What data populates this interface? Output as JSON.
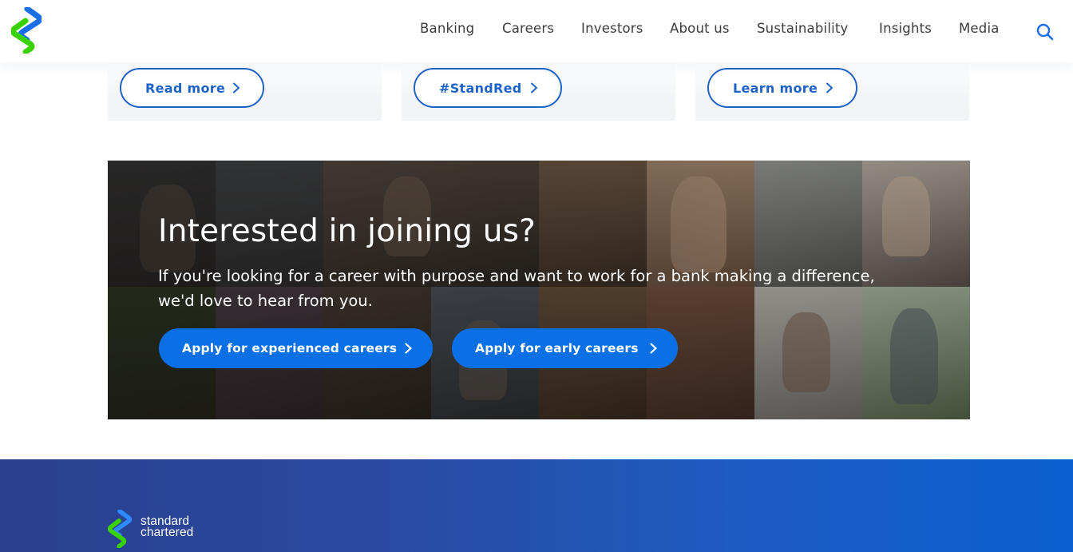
{
  "header": {
    "nav": [
      {
        "label": "Banking"
      },
      {
        "label": "Careers"
      },
      {
        "label": "Investors"
      },
      {
        "label": "About us"
      },
      {
        "label": "Sustainability"
      },
      {
        "label": "Insights"
      },
      {
        "label": "Media"
      }
    ],
    "search_icon": "search-icon",
    "logo_icon": "standard-chartered-logo"
  },
  "cards": [
    {
      "button_label": "Read more",
      "icon": "chevron-right-icon"
    },
    {
      "button_label": "#StandRed",
      "icon": "chevron-right-icon"
    },
    {
      "button_label": "Learn more",
      "icon": "chevron-right-icon"
    }
  ],
  "banner": {
    "title": "Interested in joining us?",
    "text_line1": "If you're looking for a career with purpose and want to work for a bank making a difference,",
    "text_line2": "we'd love to hear from you.",
    "buttons": [
      {
        "label": "Apply for experienced careers",
        "icon": "chevron-right-icon"
      },
      {
        "label": "Apply for early careers",
        "icon": "chevron-right-icon"
      }
    ],
    "background": "photo-collage"
  },
  "footer": {
    "brand_line1": "standard",
    "brand_line2": "chartered"
  },
  "colors": {
    "primary_blue": "#0b6fe6",
    "outline_blue": "#1e63c6",
    "brand_green": "#38d200",
    "footer_navy": "#2b3f8f"
  }
}
